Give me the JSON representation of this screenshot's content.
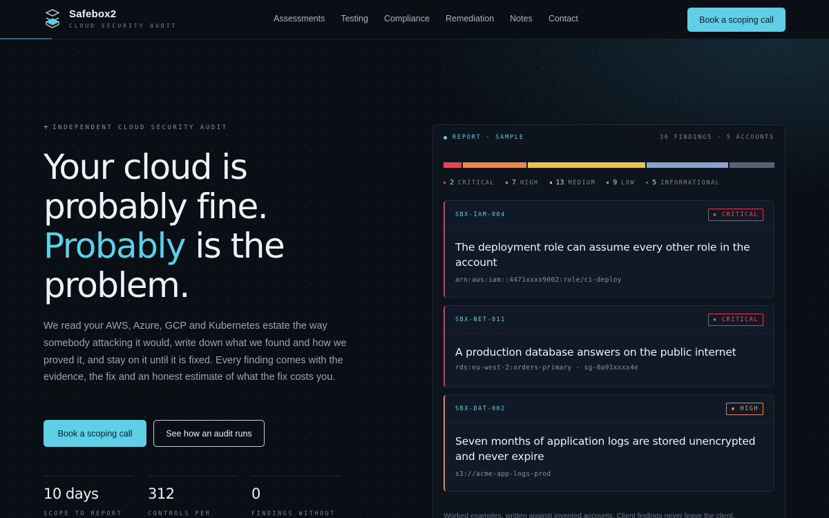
{
  "nav": {
    "brand_name": "Safebox2",
    "brand_tagline": "CLOUD SECURITY AUDIT",
    "links": [
      "Assessments",
      "Testing",
      "Compliance",
      "Remediation",
      "Notes",
      "Contact"
    ],
    "cta": "Book a scoping call"
  },
  "hero": {
    "eyebrow": "INDEPENDENT CLOUD SECURITY AUDIT",
    "headline_line1": "Your cloud is",
    "headline_line2": "probably fine.",
    "headline_accent": "Probably",
    "headline_line3_rest": " is the",
    "headline_line4": "problem.",
    "lede": "We read your AWS, Azure, GCP and Kubernetes estate the way somebody attacking it would, write down what we found and how we proved it, and stay on it until it is fixed. Every finding comes with the evidence, the fix and an honest estimate of what the fix costs you.",
    "primary_button": "Book a scoping call",
    "secondary_button": "See how an audit runs",
    "stats": [
      {
        "value": "10 days",
        "label": "SCOPE TO REPORT"
      },
      {
        "value": "312",
        "label": "CONTROLS PER"
      },
      {
        "value": "0",
        "label": "FINDINGS WITHOUT"
      }
    ]
  },
  "report": {
    "label": "REPORT · SAMPLE",
    "count": "36 FINDINGS · 5 ACCOUNTS",
    "severities": [
      {
        "count": "2",
        "name": "CRITICAL",
        "value": 2,
        "color": "#e0485a"
      },
      {
        "count": "7",
        "name": "HIGH",
        "value": 7,
        "color": "#e98a4c"
      },
      {
        "count": "13",
        "name": "MEDIUM",
        "value": 13,
        "color": "#e9c24f"
      },
      {
        "count": "9",
        "name": "LOW",
        "value": 9,
        "color": "#8da2c6"
      },
      {
        "count": "5",
        "name": "INFORMATIONAL",
        "value": 5,
        "color": "#5a6372"
      }
    ],
    "findings": [
      {
        "id": "SBX-IAM-004",
        "severity": "▪ CRITICAL",
        "title": "The deployment role can assume every other role in the account",
        "resource": "arn:aws:iam::4471xxxx9002:role/ci-deploy"
      },
      {
        "id": "SBX-NET-011",
        "severity": "▪ CRITICAL",
        "title": "A production database answers on the public internet",
        "resource": "rds:eu-west-2:orders-primary · sg-0a91xxxx4e"
      },
      {
        "id": "SBX-DAT-002",
        "severity": "▪ HIGH",
        "title": "Seven months of application logs are stored unencrypted and never expire",
        "resource": "s3://acme-app-logs-prod"
      }
    ],
    "footnote": "Worked examples, written against invented accounts. Client findings never leave the client."
  }
}
